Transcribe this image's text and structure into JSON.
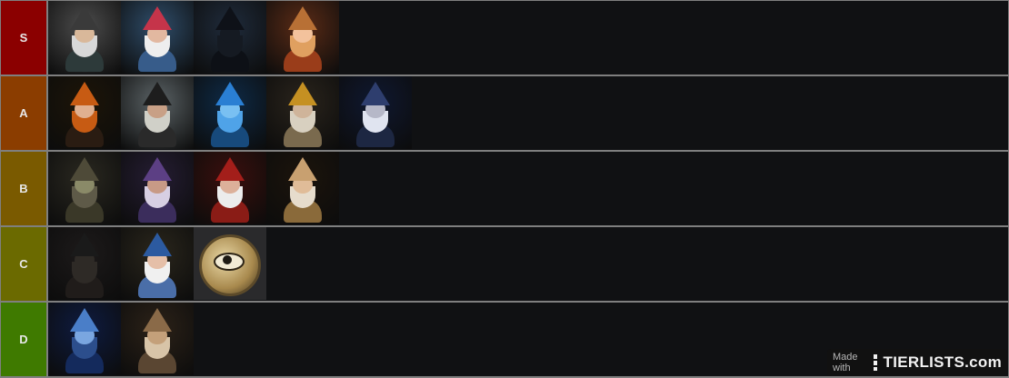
{
  "tiers": [
    {
      "label": "S",
      "color": "#8b0000",
      "items": [
        {
          "name": "gnome-broom",
          "sky": "#4c4c4c",
          "hat": "#3a3a3a",
          "face": "#d9b89a",
          "beard": "#d8d8d8",
          "body": "#2d3a3a"
        },
        {
          "name": "gnome-colorful",
          "sky": "#2f4d6a",
          "hat": "#c5344a",
          "face": "#e2b8a0",
          "beard": "#eeeeee",
          "body": "#375c8a"
        },
        {
          "name": "dark-cat",
          "sky": "#1f2b3b",
          "hat": "#0e1118",
          "face": "#151a22",
          "beard": "#151a22",
          "body": "#0d1016"
        },
        {
          "name": "smiling-witch",
          "sky": "#5a2b16",
          "hat": "#b87035",
          "face": "#f3c29c",
          "beard": "#e0a060",
          "body": "#9a3d1a"
        }
      ]
    },
    {
      "label": "A",
      "color": "#8b3d00",
      "items": [
        {
          "name": "red-haired-girl",
          "sky": "#1d1508",
          "hat": "#c75b13",
          "face": "#e0b090",
          "beard": "#c75b13",
          "body": "#2a1c12"
        },
        {
          "name": "old-wizard-beard",
          "sky": "#5b6366",
          "hat": "#1d1d1d",
          "face": "#c8a086",
          "beard": "#d0d0c8",
          "body": "#2a2a2a"
        },
        {
          "name": "blue-ghost",
          "sky": "#0e2a46",
          "hat": "#2a7fd3",
          "face": "#79c0f2",
          "beard": "#4fa3e8",
          "body": "#174a7c"
        },
        {
          "name": "yellow-hat-gnome",
          "sky": "#2a241c",
          "hat": "#c59022",
          "face": "#cfb49a",
          "beard": "#d8d0c0",
          "body": "#7a6a4e"
        },
        {
          "name": "gnome-in-stars",
          "sky": "#0f1830",
          "hat": "#2e3e6e",
          "face": "#b6b8c8",
          "beard": "#e0e4f0",
          "body": "#1d2742"
        }
      ]
    },
    {
      "label": "B",
      "color": "#7a5a00",
      "items": [
        {
          "name": "goblin-group",
          "sky": "#2a2820",
          "hat": "#4e4a38",
          "face": "#8a8a68",
          "beard": "#5e5a48",
          "body": "#3a3828"
        },
        {
          "name": "purple-wizard",
          "sky": "#251d33",
          "hat": "#5c3f84",
          "face": "#c89a86",
          "beard": "#d7cfe3",
          "body": "#3b2d5c"
        },
        {
          "name": "red-wizard-fire",
          "sky": "#3a0f0d",
          "hat": "#a31e1a",
          "face": "#dcb09a",
          "beard": "#ececec",
          "body": "#8a1c16"
        },
        {
          "name": "gnome-honey-pot",
          "sky": "#1c140c",
          "hat": "#c8a070",
          "face": "#e0bc98",
          "beard": "#e6dccc",
          "body": "#8a6a3a"
        }
      ]
    },
    {
      "label": "C",
      "color": "#6b6a00",
      "items": [
        {
          "name": "black-hat-cat",
          "sky": "#1d1a1a",
          "hat": "#1a1a1a",
          "face": "#2e2a26",
          "beard": "#2e2a26",
          "body": "#201c1a"
        },
        {
          "name": "blue-hat-gnome",
          "sky": "#2a261c",
          "hat": "#2c5aa0",
          "face": "#e5bfa8",
          "beard": "#f0f0f0",
          "body": "#4a6ea8"
        },
        {
          "name": "eye-coin",
          "coin": true
        }
      ]
    },
    {
      "label": "D",
      "color": "#3f7a00",
      "items": [
        {
          "name": "space-serpent",
          "sky": "#0e1b40",
          "hat": "#4a7ec8",
          "face": "#7aa6e0",
          "beard": "#2c4e8c",
          "body": "#142a5c"
        },
        {
          "name": "cat-in-window",
          "sky": "#2c2218",
          "hat": "#8a6a48",
          "face": "#c4a07a",
          "beard": "#d8c4a8",
          "body": "#5a4632"
        }
      ]
    }
  ],
  "watermark": {
    "made_with": "Made with",
    "brand": "TIERLISTS.com"
  }
}
